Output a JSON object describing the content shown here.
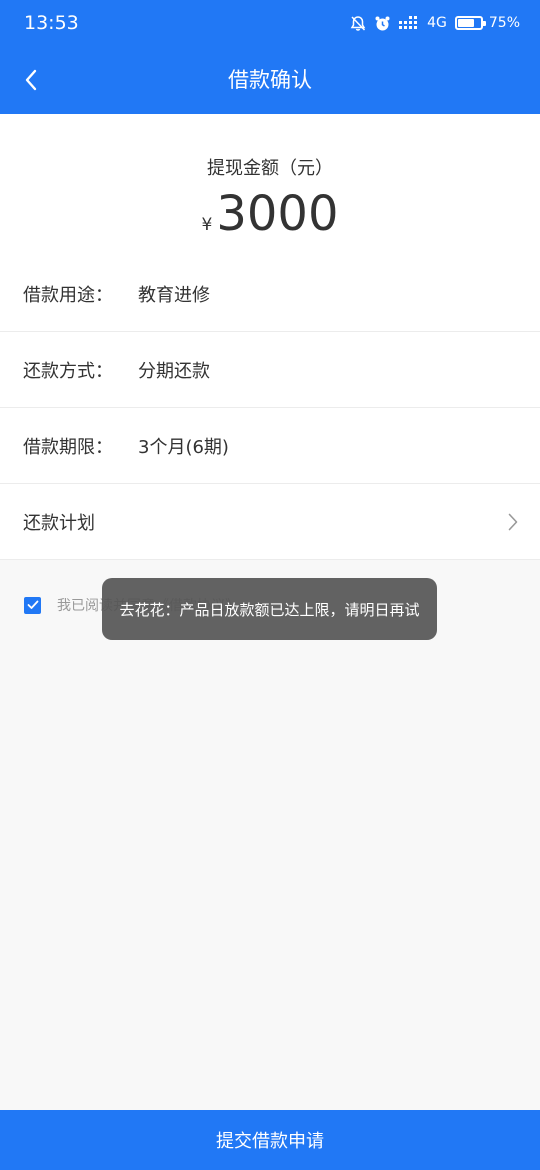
{
  "status_bar": {
    "time": "13:53",
    "network": "4G",
    "battery_percent_label": "75%",
    "battery_level": 0.75
  },
  "nav": {
    "title": "借款确认",
    "back_icon": "chevron-left-icon"
  },
  "amount": {
    "label": "提现金额（元）",
    "currency": "¥",
    "value": "3000"
  },
  "rows": [
    {
      "label": "借款用途：",
      "value": "教育进修"
    },
    {
      "label": "还款方式：",
      "value": "分期还款"
    },
    {
      "label": "借款期限：",
      "value": "3个月(6期)"
    },
    {
      "label": "还款计划",
      "value": ""
    }
  ],
  "agreement": {
    "checked": true,
    "text": "我已阅读并同意《借款协议》"
  },
  "toast": {
    "message": "去花花：产品日放款额已达上限，请明日再试"
  },
  "submit": {
    "label": "提交借款申请"
  },
  "colors": {
    "primary": "#2178f5",
    "toast_bg": "#555555"
  }
}
